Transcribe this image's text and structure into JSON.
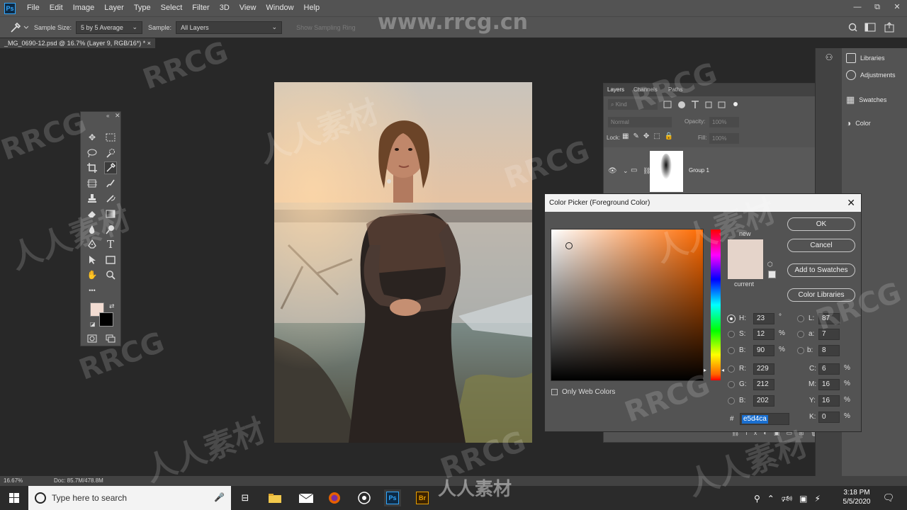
{
  "menubar": {
    "app_logo": "Ps",
    "items": [
      "File",
      "Edit",
      "Image",
      "Layer",
      "Type",
      "Select",
      "Filter",
      "3D",
      "View",
      "Window",
      "Help"
    ],
    "window_controls": [
      "—",
      "⧉",
      "✕"
    ]
  },
  "options_bar": {
    "sample_size_label": "Sample Size:",
    "sample_size_value": "5 by 5 Average",
    "sample_label": "Sample:",
    "sample_value": "All Layers",
    "sampling_ring": "Show Sampling Ring"
  },
  "document": {
    "tab_title": "_MG_0690-12.psd @ 16.7% (Layer 9, RGB/16*) *",
    "tab_close": "×"
  },
  "watermark": {
    "url": "www.rrcg.cn",
    "latin": "RRCG",
    "cjk": "人人素材"
  },
  "toolbar": {
    "foreground_color": "#f2dcd2",
    "background_color": "#000000",
    "more_tools": "•••"
  },
  "layers_panel": {
    "tabs": [
      "Layers",
      "Channels",
      "Paths"
    ],
    "filter_placeholder": "Kind",
    "blend_mode": "Normal",
    "opacity_label": "Opacity:",
    "opacity_value": "100%",
    "lock_label": "Lock:",
    "fill_label": "Fill:",
    "fill_value": "100%",
    "layer_name": "Group 1"
  },
  "dock": {
    "items": [
      {
        "label": "Libraries",
        "icon": "libraries-icon"
      },
      {
        "label": "Adjustments",
        "icon": "adjustments-icon"
      },
      {
        "label": "Swatches",
        "icon": "swatches-icon"
      },
      {
        "label": "Color",
        "icon": "color-icon"
      }
    ]
  },
  "color_picker": {
    "title": "Color Picker (Foreground Color)",
    "close": "✕",
    "new_label": "new",
    "current_label": "current",
    "new_color": "#e5d4ca",
    "current_color": "#e5d4ca",
    "buttons": {
      "ok": "OK",
      "cancel": "Cancel",
      "add_swatches": "Add to Swatches",
      "color_libraries": "Color Libraries"
    },
    "only_web_colors": "Only Web Colors",
    "hsb": {
      "h_label": "H:",
      "h": "23",
      "h_unit": "°",
      "s_label": "S:",
      "s": "12",
      "s_unit": "%",
      "b_label": "B:",
      "b": "90",
      "b_unit": "%"
    },
    "rgb": {
      "r_label": "R:",
      "r": "229",
      "g_label": "G:",
      "g": "212",
      "b_label": "B:",
      "b": "202"
    },
    "lab": {
      "l_label": "L:",
      "l": "87",
      "a_label": "a:",
      "a": "7",
      "b_label": "b:",
      "b": "8"
    },
    "cmyk": {
      "c_label": "C:",
      "c": "6",
      "m_label": "M:",
      "m": "16",
      "y_label": "Y:",
      "y": "16",
      "k_label": "K:",
      "k": "0",
      "unit": "%"
    },
    "hex_label": "#",
    "hex": "e5d4ca"
  },
  "status_bar": {
    "zoom": "16.67%",
    "doc_size": "Doc: 85.7M/478.8M"
  },
  "taskbar": {
    "search_placeholder": "Type here to search",
    "time": "3:18 PM",
    "date": "5/5/2020"
  }
}
